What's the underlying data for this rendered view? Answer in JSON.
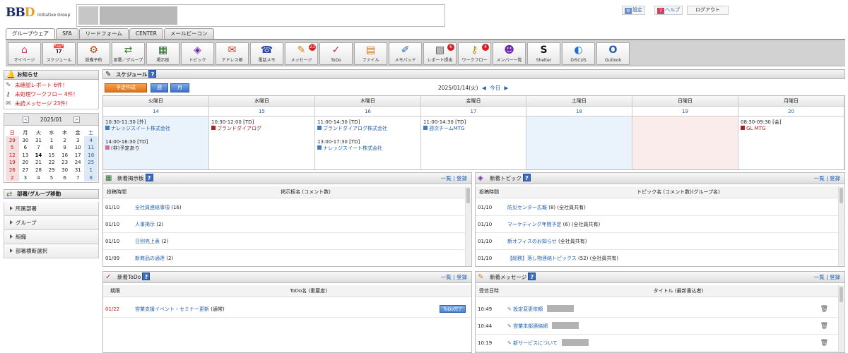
{
  "brand": {
    "logo_text": "BBD",
    "logo_sub": "Initiative Group"
  },
  "toplinks": [
    {
      "label": "設定",
      "icon": "settings-icon",
      "x": 0
    },
    {
      "label": "ヘルプ",
      "icon": "help-icon",
      "x": 0
    },
    {
      "label": "ログアウト",
      "icon": "logout-icon",
      "x": 0
    }
  ],
  "tabs": [
    "グループウェア",
    "SFA",
    "リードフォーム",
    "CENTER",
    "メールビーコン"
  ],
  "iconbar": [
    {
      "label": "マイページ",
      "icon": "home-icon",
      "glyph": "⌂",
      "color": "#d93a6a",
      "badge": ""
    },
    {
      "label": "スケジュール",
      "icon": "calendar-icon",
      "glyph": "📅",
      "color": "#333",
      "badge": ""
    },
    {
      "label": "設備予約",
      "icon": "facility-icon",
      "glyph": "⚙",
      "color": "#c04010",
      "badge": ""
    },
    {
      "label": "部署／グループ",
      "icon": "group-icon",
      "glyph": "⇄",
      "color": "#3a8a2a",
      "badge": ""
    },
    {
      "label": "掲示板",
      "icon": "board-icon",
      "glyph": "▦",
      "color": "#2a6a2a",
      "badge": ""
    },
    {
      "label": "トピック",
      "icon": "topic-icon",
      "glyph": "◈",
      "color": "#6a2aa0",
      "badge": ""
    },
    {
      "label": "アドレス帳",
      "icon": "address-book-icon",
      "glyph": "✉",
      "color": "#c03020",
      "badge": ""
    },
    {
      "label": "電話メモ",
      "icon": "phone-memo-icon",
      "glyph": "☎",
      "color": "#2a4aa0",
      "badge": ""
    },
    {
      "label": "メッセージ",
      "icon": "message-icon",
      "glyph": "✎",
      "color": "#d08020",
      "badge": "23"
    },
    {
      "label": "ToDo",
      "icon": "todo-icon",
      "glyph": "✓",
      "color": "#c03020",
      "badge": ""
    },
    {
      "label": "ファイル",
      "icon": "file-icon",
      "glyph": "▤",
      "color": "#d07010",
      "badge": ""
    },
    {
      "label": "メモパッド",
      "icon": "memopad-icon",
      "glyph": "✐",
      "color": "#2a6ab0",
      "badge": ""
    },
    {
      "label": "レポート提出",
      "icon": "report-icon",
      "glyph": "▧",
      "color": "#555",
      "badge": "6"
    },
    {
      "label": "ワークフロー",
      "icon": "workflow-icon",
      "glyph": "⚷",
      "color": "#c09010",
      "badge": "4"
    },
    {
      "label": "メンバー一覧",
      "icon": "members-icon",
      "glyph": "☻",
      "color": "#6a2ab0",
      "badge": ""
    },
    {
      "label": "Shelter",
      "icon": "shelter-icon",
      "glyph": "S",
      "color": "#111",
      "badge": ""
    },
    {
      "label": "DiSCUS",
      "icon": "discus-icon",
      "glyph": "◐",
      "color": "#1f6fd0",
      "badge": ""
    },
    {
      "label": "Outlook",
      "icon": "outlook-icon",
      "glyph": "O",
      "color": "#1f5fb0",
      "badge": ""
    }
  ],
  "notice": {
    "title": "お知らせ",
    "items": [
      {
        "text": "未確認レポート 6件！",
        "icon": "report-icon"
      },
      {
        "text": "未処理ワークフロー 4件！",
        "icon": "workflow-icon"
      },
      {
        "text": "未読メッセージ 23件！",
        "icon": "message-icon"
      }
    ]
  },
  "minical": {
    "month": "2025/01",
    "weekdays": [
      "日",
      "月",
      "火",
      "水",
      "木",
      "金",
      "土"
    ],
    "weeks": [
      [
        "29",
        "30",
        "31",
        "1",
        "2",
        "3",
        "4"
      ],
      [
        "5",
        "6",
        "7",
        "8",
        "9",
        "10",
        "11"
      ],
      [
        "12",
        "13",
        "14",
        "15",
        "16",
        "17",
        "18"
      ],
      [
        "19",
        "20",
        "21",
        "22",
        "23",
        "24",
        "25"
      ],
      [
        "26",
        "27",
        "28",
        "29",
        "30",
        "31",
        "1"
      ],
      [
        "2",
        "3",
        "4",
        "5",
        "6",
        "7",
        "8"
      ]
    ],
    "today": "14"
  },
  "dept": {
    "title": "部署/グループ移動",
    "items": [
      "所属部署",
      "グループ",
      "組織",
      "部署横断選択"
    ]
  },
  "schedule": {
    "title": "スケジュール",
    "new_label": "予定作成",
    "week_label": "週",
    "month_label": "月",
    "date_label": "2025/01/14(火)",
    "today_label": "今日",
    "days": [
      {
        "name": "火曜日",
        "num": "14",
        "bg": "#eaf2fb",
        "events": [
          {
            "time": "10:30-11:30 [外]",
            "name": "ナレッジスイート株式会社",
            "color": "#3d7fc6"
          },
          {
            "time": "",
            "name": "",
            "color": ""
          },
          {
            "time": "14:00-16:30 [TD]",
            "name": "(非)予定あり",
            "color": "#d0709a"
          }
        ]
      },
      {
        "name": "水曜日",
        "num": "15",
        "bg": "#fff",
        "events": [
          {
            "time": "10:30-12:00 [TD]",
            "name": "ブランドダイアログ",
            "color": "#b02020"
          }
        ]
      },
      {
        "name": "木曜日",
        "num": "16",
        "bg": "#fff",
        "events": [
          {
            "time": "11:00-14:30 [TD]",
            "name": "ブランドダイアログ株式会社",
            "color": "#3d7fc6"
          },
          {
            "time": "",
            "name": "",
            "color": ""
          },
          {
            "time": "13:00-17:30 [TD]",
            "name": "ナレッジスイート株式会社",
            "color": "#3d7fc6"
          }
        ]
      },
      {
        "name": "金曜日",
        "num": "17",
        "bg": "#fff",
        "events": [
          {
            "time": "11:00-14:30 [TD]",
            "name": "週次チームMTG",
            "color": "#3d7fc6"
          }
        ]
      },
      {
        "name": "土曜日",
        "num": "18",
        "bg": "#eaf2fb",
        "events": []
      },
      {
        "name": "日曜日",
        "num": "19",
        "bg": "#fbecec",
        "events": []
      },
      {
        "name": "月曜日",
        "num": "20",
        "bg": "#fff",
        "events": [
          {
            "time": "08:30-09:30 [会]",
            "name": "GL MTG",
            "color": "#b02020"
          }
        ]
      }
    ]
  },
  "board": {
    "title": "新着掲示板",
    "links": "一覧 | 登録",
    "col1": "投稿時間",
    "col2": "掲示板名 (コメント数)",
    "rows": [
      {
        "date": "01/10",
        "title": "全社員連絡事項",
        "count": " (16)"
      },
      {
        "date": "01/10",
        "title": "人事掲示",
        "count": " (2)"
      },
      {
        "date": "01/10",
        "title": "日別売上表",
        "count": " (2)"
      },
      {
        "date": "01/09",
        "title": "新商品の通達",
        "count": " (2)"
      }
    ]
  },
  "topic": {
    "title": "新着トピック",
    "links": "一覧 | 登録",
    "col1": "投稿時間",
    "col2": "トピック名 (コメント数)(グループ名)",
    "rows": [
      {
        "date": "01/10",
        "title": "防災センター広報",
        "count": " (8) (全社員共有)"
      },
      {
        "date": "01/10",
        "title": "マーケティング年間予定",
        "count": " (6) (全社員共有)"
      },
      {
        "date": "01/10",
        "title": "新オフィスのお知らせ",
        "count": " (全社員共有)"
      },
      {
        "date": "01/10",
        "title": "【総務】落し物連絡トピックス",
        "count": " (52) (全社員共有)"
      }
    ]
  },
  "todo": {
    "title": "新着ToDo",
    "links": "一覧 | 登録",
    "col1": "期限",
    "col2": "ToDo名 (重要度)",
    "rows": [
      {
        "date": "01/22",
        "title": "営業支援イベント・セミナー更新",
        "count": " (通常)",
        "button": "ToDo完了"
      }
    ]
  },
  "messages": {
    "title": "新着メッセージ",
    "links": "一覧 | 登録",
    "col1": "受信日時",
    "col2": "タイトル (最新書込者)",
    "rows": [
      {
        "date": "10:49",
        "title": "設定変更依頼"
      },
      {
        "date": "10:44",
        "title": "営業本部連絡網"
      },
      {
        "date": "10:19",
        "title": "新サービスについて"
      }
    ]
  }
}
